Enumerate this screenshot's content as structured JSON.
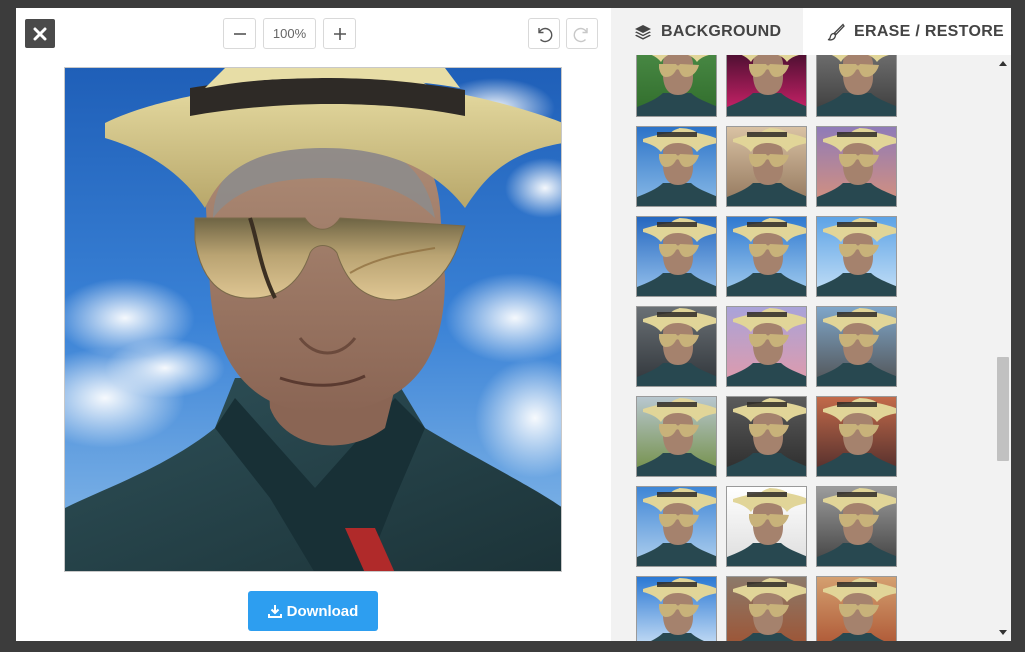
{
  "toolbar": {
    "zoom_level": "100%"
  },
  "download": {
    "label": "Download"
  },
  "tabs": [
    {
      "label": "BACKGROUND",
      "icon": "layers-icon",
      "active": true
    },
    {
      "label": "ERASE / RESTORE",
      "icon": "brush-icon",
      "active": false
    }
  ],
  "backgrounds": [
    {
      "name": "beach-palm",
      "top": "#4e8f4a",
      "bottom": "#2f6b2a"
    },
    {
      "name": "neon-lights",
      "top": "#2a0a22",
      "bottom": "#d8246e"
    },
    {
      "name": "dark-gray",
      "top": "#7a7a7a",
      "bottom": "#3a3a3a"
    },
    {
      "name": "blue-sky",
      "top": "#2c73c8",
      "bottom": "#8dbde8"
    },
    {
      "name": "wooden-wall",
      "top": "#d9c2a3",
      "bottom": "#8f735a"
    },
    {
      "name": "purple-sunset",
      "top": "#8f7bb8",
      "bottom": "#d9927a"
    },
    {
      "name": "blue-sky-2",
      "top": "#2467c0",
      "bottom": "#9cc6ee"
    },
    {
      "name": "blue-sky-3",
      "top": "#2f79d0",
      "bottom": "#a8d0f0"
    },
    {
      "name": "light-sky",
      "top": "#5da3e6",
      "bottom": "#c9e2f7"
    },
    {
      "name": "city-building",
      "top": "#6a7075",
      "bottom": "#2e3338"
    },
    {
      "name": "pink-twilight",
      "top": "#a9a3d9",
      "bottom": "#e39aa8"
    },
    {
      "name": "highway-mountains",
      "top": "#7fa6c9",
      "bottom": "#4f4f4f"
    },
    {
      "name": "green-fields",
      "top": "#b8c7cf",
      "bottom": "#6f8c3f"
    },
    {
      "name": "dark-room",
      "top": "#5b5b5b",
      "bottom": "#2a2a2a"
    },
    {
      "name": "orange-sunset",
      "top": "#c26a4a",
      "bottom": "#4a2a2a"
    },
    {
      "name": "clouds-blue",
      "top": "#3f86d6",
      "bottom": "#b5d3ef"
    },
    {
      "name": "white-studio",
      "top": "#ffffff",
      "bottom": "#dcdcdc"
    },
    {
      "name": "silver-arch",
      "top": "#9c9c9c",
      "bottom": "#3e3e3e"
    },
    {
      "name": "bright-clouds",
      "top": "#2a78d4",
      "bottom": "#e0eefa"
    },
    {
      "name": "brick-street",
      "top": "#8c7a6a",
      "bottom": "#a04e2c"
    },
    {
      "name": "desert-road",
      "top": "#d4a070",
      "bottom": "#a84c2c"
    }
  ]
}
